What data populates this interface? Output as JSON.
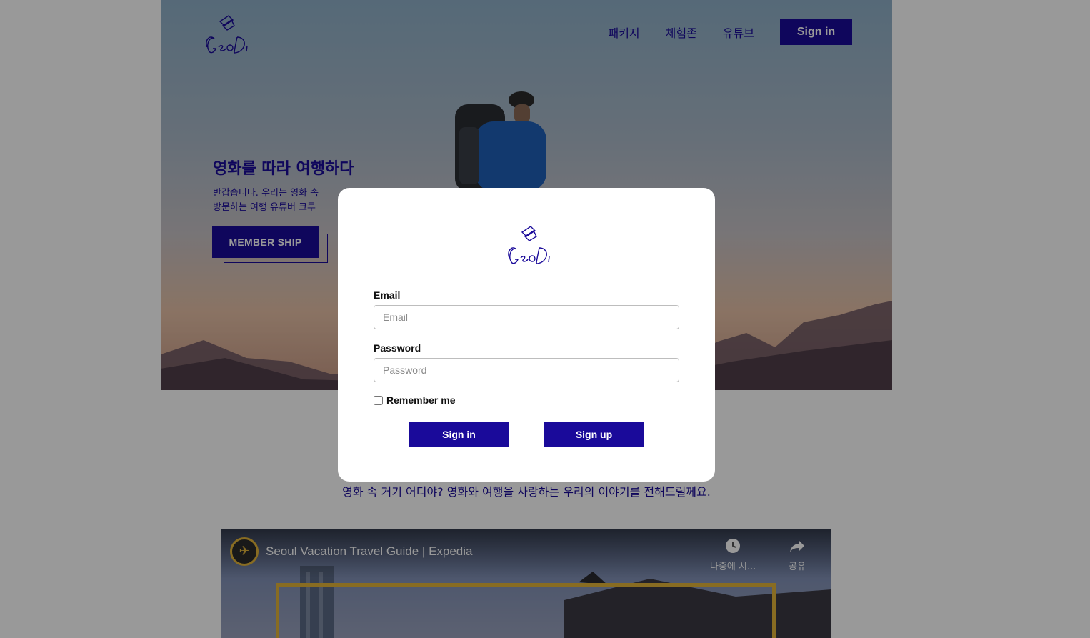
{
  "brand": {
    "logo_text": "GeoDi"
  },
  "nav": {
    "links": [
      "패키지",
      "체험존",
      "유튜브"
    ],
    "signin_label": "Sign in"
  },
  "hero": {
    "title": "영화를 따라 여행하다",
    "desc_line1": "반갑습니다. 우리는 영화 속 ",
    "desc_line2": "방문하는 여행 유튜버 크루 ",
    "member_label": "MEMBER SHIP"
  },
  "tagline": "영화 속 거기 어디야? 영화와 여행을 사랑하는 우리의 이야기를 전해드릴께요.",
  "video": {
    "title": "Seoul Vacation Travel Guide | Expedia",
    "watch_later": "나중에 시...",
    "share": "공유"
  },
  "modal": {
    "email_label": "Email",
    "email_placeholder": "Email",
    "password_label": "Password",
    "password_placeholder": "Password",
    "remember_label": "Remember me",
    "signin_label": "Sign in",
    "signup_label": "Sign up"
  },
  "colors": {
    "brand": "#1a0a9a",
    "overlay": "rgba(0,0,0,0.4)",
    "video_accent": "#e3b43a"
  }
}
